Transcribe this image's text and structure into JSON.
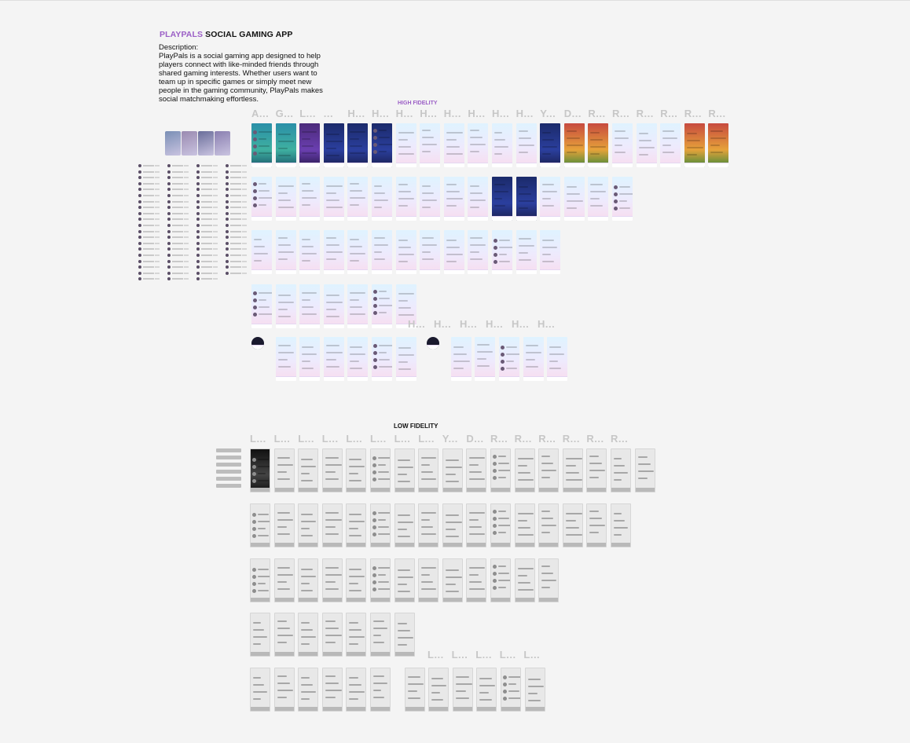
{
  "header": {
    "brand": "PLAYPALS",
    "title_rest": " SOCIAL GAMING APP",
    "description_label": "Description:",
    "description": "PlayPals is a social gaming app designed to help players connect with like-minded friends through shared gaming interests. Whether users want to team up in specific games or simply meet new people in the gaming community, PlayPals makes social matchmaking effortless."
  },
  "sections": {
    "high_fidelity": "HIGH FIDELITY",
    "low_fidelity": "LOW FIDELITY"
  },
  "hf_frame_labels": [
    "A...",
    "G...",
    "L...",
    "...",
    "H...",
    "H...",
    "H...",
    "H...",
    "H...",
    "H...",
    "H...",
    "H...",
    "Y...",
    "D...",
    "R...",
    "R...",
    "R...",
    "R...",
    "R...",
    "R..."
  ],
  "hf_row4_labels": [
    "H...",
    "H...",
    "H...",
    "H...",
    "H...",
    "H..."
  ],
  "lf_frame_labels": [
    "L...",
    "L...",
    "L...",
    "L...",
    "L...",
    "L...",
    "L...",
    "L...",
    "Y...",
    "D...",
    "R...",
    "R...",
    "R...",
    "R...",
    "R...",
    "R..."
  ],
  "lf_row4_labels": [
    "L...",
    "L...",
    "L...",
    "L...",
    "L..."
  ],
  "colors": {
    "brand_purple": "#9b5fc6",
    "canvas": "#f4f4f4",
    "frame_label": "#c7c7c7"
  }
}
